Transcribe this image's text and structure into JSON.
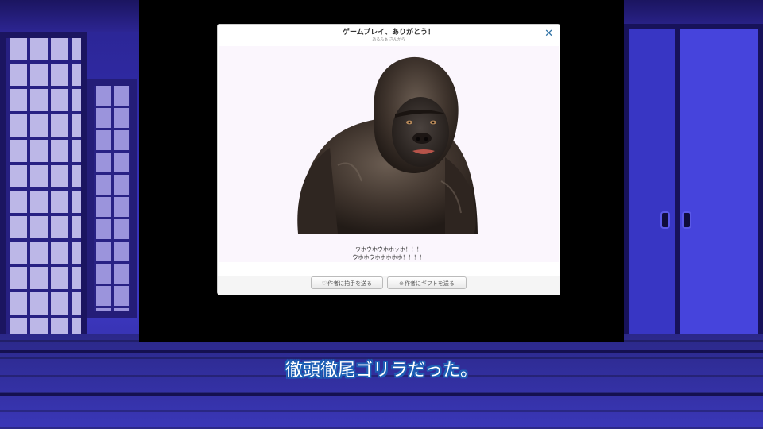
{
  "dialog": {
    "title": "ゲームプレイ、ありがとう！",
    "author": "あるふぁ さんから",
    "close_icon": "✕",
    "image": "gorilla-photo",
    "message_line1": "ウホウホウホホッホ！！！",
    "message_line2": "ウホホウホホホホホ！！！！",
    "clap_button": "作者に拍手を送る",
    "gift_button": "作者にギフトを送る"
  },
  "subtitle": "徹頭徹尾ゴリラだった。",
  "colors": {
    "subtitle_outline": "#1d5fb5",
    "close_icon": "#2c6fa3",
    "room": "#3530b8"
  }
}
